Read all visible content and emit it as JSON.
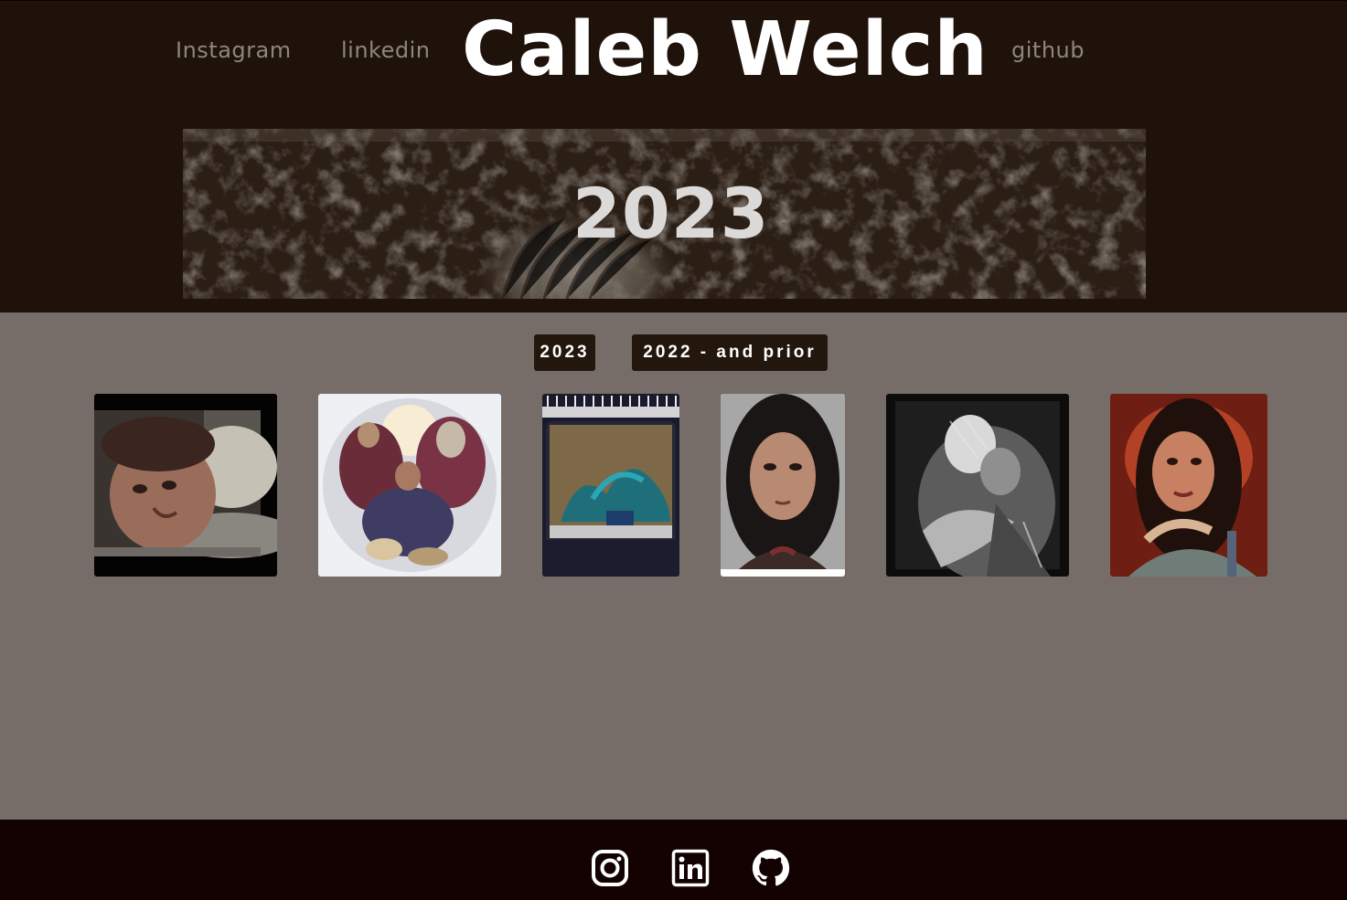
{
  "header": {
    "title": "Caleb Welch",
    "nav_left": [
      "Instagram",
      "linkedin"
    ],
    "nav_right": [
      "github"
    ]
  },
  "banner": {
    "year": "2023"
  },
  "year_tabs": [
    {
      "label": "2023"
    },
    {
      "label": "2022 - and prior"
    }
  ],
  "gallery": {
    "items": [
      {
        "subject": "portrait-man-lying-down"
      },
      {
        "subject": "coronation-painting"
      },
      {
        "subject": "sketchbook-landscape"
      },
      {
        "subject": "portrait-woman-dark-hair"
      },
      {
        "subject": "embrace-black-and-white"
      },
      {
        "subject": "portrait-woman-red-background"
      }
    ]
  },
  "footer": {
    "icons": [
      "instagram-icon",
      "linkedin-icon",
      "github-icon"
    ]
  },
  "colors": {
    "header_bg": "#1f120a",
    "body_bg": "#766d68",
    "footer_bg": "#140202",
    "nav_text": "#8e8580",
    "button_bg": "#23160d"
  }
}
